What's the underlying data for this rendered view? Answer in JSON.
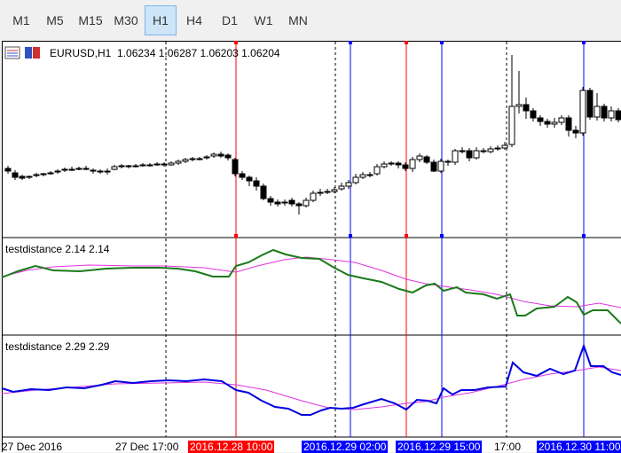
{
  "timeframes": [
    {
      "label": "M1",
      "active": false
    },
    {
      "label": "M5",
      "active": false
    },
    {
      "label": "M15",
      "active": false
    },
    {
      "label": "M30",
      "active": false
    },
    {
      "label": "H1",
      "active": true
    },
    {
      "label": "H4",
      "active": false
    },
    {
      "label": "D1",
      "active": false
    },
    {
      "label": "W1",
      "active": false
    },
    {
      "label": "MN",
      "active": false
    }
  ],
  "main_panel": {
    "symbol_label": "EURUSD,H1",
    "ohlc": "1.06234 1.06287 1.06203 1.06204"
  },
  "indicator1": {
    "label": "testdistance 2.14 2.14"
  },
  "indicator2": {
    "label": "testdistance 2.29 2.29"
  },
  "time_axis": [
    {
      "text": "27 Dec 2016",
      "style": "plain"
    },
    {
      "text": "27 Dec 17:00",
      "style": "plain"
    },
    {
      "text": "2016.12.28 10:00",
      "style": "red"
    },
    {
      "text": "2016.12.29 02:00",
      "style": "blue"
    },
    {
      "text": "2016.12.29 15:00",
      "style": "blue"
    },
    {
      "text": "17:00",
      "style": "plain"
    },
    {
      "text": "2016.12.30 11:00",
      "style": "blue"
    }
  ],
  "colors": {
    "red_line": "#ff0000",
    "blue_line": "#0000ff",
    "green_series": "#1a7a1a",
    "magenta_series": "#e033e0",
    "blue_series": "#0000e0"
  }
}
